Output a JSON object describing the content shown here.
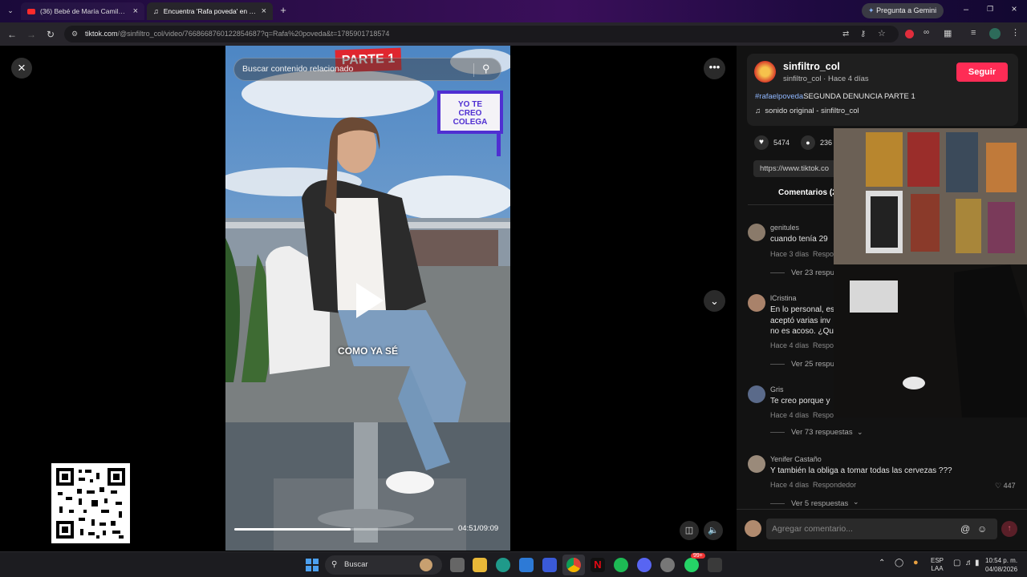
{
  "browser": {
    "tabs": [
      {
        "title": "(36) Bebé de María Camila Poto...",
        "active": false
      },
      {
        "title": "Encuentra 'Rafa poveda' en TikT...",
        "active": true
      }
    ],
    "gemini_button": "Pregunta a Gemini",
    "url_host": "tiktok.com",
    "url_path": "/@sinfiltro_col/video/7668668760122854687?q=Rafa%20poveda&t=1785901718574"
  },
  "video": {
    "search_placeholder": "Buscar contenido relacionado",
    "overlay_parte": "PARTE 1",
    "overlay_badge": "YO TE CREO COLEGA",
    "caption": "COMO YA SÉ",
    "time": "04:51/09:09",
    "progress": 0.53
  },
  "panel": {
    "username": "sinfiltro_col",
    "subline": "sinfiltro_col · Hace 4 días",
    "follow_label": "Seguir",
    "hashtag": "#rafaelpoveda",
    "description": "SEGUNDA DENUNCIA PARTE 1",
    "sound": "sonido original - sinfiltro_col",
    "likes": "5474",
    "comments_count": "236",
    "link_text": "https://www.tiktok.co",
    "comments_tab": "Comentarios (2",
    "comment_placeholder": "Agregar comentario...",
    "comments": [
      {
        "name": "genitules",
        "text": "cuando tenía 29",
        "meta": "Hace 3 días",
        "reply": "Respo",
        "replies": "Ver 23 respu"
      },
      {
        "name": "lCristina",
        "text": "En lo personal, es\naceptó varias inv\nno es acoso. ¿Qu",
        "meta": "Hace 4 días",
        "reply": "Respo",
        "replies": "Ver 25 respu"
      },
      {
        "name": "Gris",
        "text": "Te creo porque y",
        "meta": "Hace 4 días",
        "reply": "Respo",
        "replies": "Ver 73 respuestas"
      },
      {
        "name": "Yenifer Castaño",
        "text": "Y también la obliga a tomar todas las cervezas ???",
        "meta": "Hace 4 días",
        "reply": "Respondedor",
        "likes": "447",
        "replies": "Ver 5 respuestas"
      }
    ]
  },
  "taskbar": {
    "search": "Buscar",
    "lang1": "ESP",
    "lang2": "LAA",
    "time": "10:54 p. m.",
    "date": "04/08/2026",
    "badge": "99+"
  },
  "colors": {
    "accent": "#fe2c55",
    "tiktok_link": "#8fb7ff"
  }
}
